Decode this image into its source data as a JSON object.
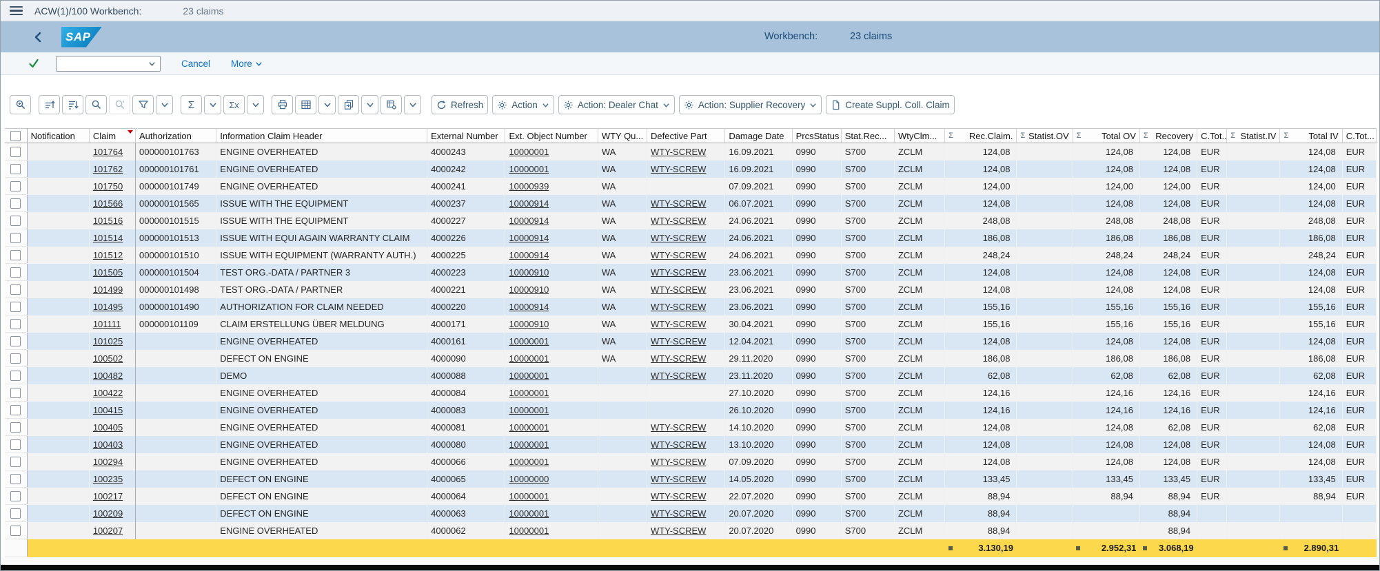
{
  "window": {
    "title": "ACW(1)/100 Workbench:",
    "subtitle": "23 claims"
  },
  "appbar": {
    "brand": "SAP",
    "workbench_label": "Workbench:",
    "workbench_value": "23 claims"
  },
  "actionbar": {
    "combobox_value": "",
    "cancel_label": "Cancel",
    "more_label": "More"
  },
  "toolbar": {
    "sum_icon": "Σ",
    "subtotal_icon": "Σx",
    "refresh_label": "Refresh",
    "action_label": "Action",
    "dealer_chat_label": "Action: Dealer Chat",
    "supplier_recovery_label": "Action: Supplier Recovery",
    "create_claim_label": "Create Suppl. Coll. Claim"
  },
  "colors": {
    "appbar_blue": "#a8c2db",
    "link_blue": "#0a6ed1",
    "zebra_blue": "#d9e6f4",
    "zebra_gray": "#f2f2f2",
    "totals_yellow": "#fbd84c",
    "sort_indicator_red": "#c40000",
    "check_green": "#188a3f"
  },
  "table": {
    "sigma_icon": "Σ",
    "columns": {
      "notification": "Notification",
      "claim": "Claim",
      "authorization": "Authorization",
      "info_header": "Information Claim Header",
      "ext_number": "External Number",
      "ext_object": "Ext. Object Number",
      "wty_qu": "WTY Qu...",
      "defective_part": "Defective Part",
      "damage_date": "Damage Date",
      "prcs_status": "PrcsStatus",
      "stat_rec": "Stat.Rec...",
      "wty_clm": "WtyClm...",
      "rec_claim": "Rec.Claim.",
      "statist_ov": "Statist.OV",
      "total_ov": "Total OV",
      "recovery": "Recovery",
      "c_tot1": "C.Tot...",
      "statist_iv": "Statist.IV",
      "total_iv": "Total IV",
      "c_tot2": "C.Tot..."
    },
    "rows": [
      [
        "",
        "101764",
        "000000101763",
        "ENGINE OVERHEATED",
        "4000243",
        "10000001",
        "WA",
        "WTY-SCREW",
        "16.09.2021",
        "0990",
        "S700",
        "ZCLM",
        "124,08",
        "",
        "124,08",
        "124,08",
        "EUR",
        "",
        "124,08",
        "EUR"
      ],
      [
        "",
        "101762",
        "000000101761",
        "ENGINE OVERHEATED",
        "4000242",
        "10000001",
        "WA",
        "WTY-SCREW",
        "16.09.2021",
        "0990",
        "S700",
        "ZCLM",
        "124,08",
        "",
        "124,08",
        "124,08",
        "EUR",
        "",
        "124,08",
        "EUR"
      ],
      [
        "",
        "101750",
        "000000101749",
        "ENGINE OVERHEATED",
        "4000241",
        "10000939",
        "WA",
        "",
        "07.09.2021",
        "0990",
        "S700",
        "ZCLM",
        "124,00",
        "",
        "124,00",
        "124,00",
        "EUR",
        "",
        "124,00",
        "EUR"
      ],
      [
        "",
        "101566",
        "000000101565",
        "ISSUE WITH THE EQUIPMENT",
        "4000237",
        "10000914",
        "WA",
        "WTY-SCREW",
        "06.07.2021",
        "0990",
        "S700",
        "ZCLM",
        "124,08",
        "",
        "124,08",
        "124,08",
        "EUR",
        "",
        "124,08",
        "EUR"
      ],
      [
        "",
        "101516",
        "000000101515",
        "ISSUE WITH THE EQUIPMENT",
        "4000227",
        "10000914",
        "WA",
        "WTY-SCREW",
        "24.06.2021",
        "0990",
        "S700",
        "ZCLM",
        "248,08",
        "",
        "248,08",
        "248,08",
        "EUR",
        "",
        "248,08",
        "EUR"
      ],
      [
        "",
        "101514",
        "000000101513",
        "ISSUE WITH EQUI AGAIN WARRANTY CLAIM",
        "4000226",
        "10000914",
        "WA",
        "WTY-SCREW",
        "24.06.2021",
        "0990",
        "S700",
        "ZCLM",
        "186,08",
        "",
        "186,08",
        "186,08",
        "EUR",
        "",
        "186,08",
        "EUR"
      ],
      [
        "",
        "101512",
        "000000101510",
        "ISSUE WITH EQUIPMENT (WARRANTY AUTH.)",
        "4000225",
        "10000914",
        "WA",
        "WTY-SCREW",
        "24.06.2021",
        "0990",
        "S700",
        "ZCLM",
        "248,24",
        "",
        "248,24",
        "248,24",
        "EUR",
        "",
        "248,24",
        "EUR"
      ],
      [
        "",
        "101505",
        "000000101504",
        "TEST ORG.-DATA / PARTNER 3",
        "4000223",
        "10000910",
        "WA",
        "WTY-SCREW",
        "23.06.2021",
        "0990",
        "S700",
        "ZCLM",
        "124,08",
        "",
        "124,08",
        "124,08",
        "EUR",
        "",
        "124,08",
        "EUR"
      ],
      [
        "",
        "101499",
        "000000101498",
        "TEST ORG.-DATA / PARTNER",
        "4000221",
        "10000910",
        "WA",
        "WTY-SCREW",
        "23.06.2021",
        "0990",
        "S700",
        "ZCLM",
        "124,08",
        "",
        "124,08",
        "124,08",
        "EUR",
        "",
        "124,08",
        "EUR"
      ],
      [
        "",
        "101495",
        "000000101490",
        "AUTHORIZATION FOR CLAIM NEEDED",
        "4000220",
        "10000914",
        "WA",
        "WTY-SCREW",
        "23.06.2021",
        "0990",
        "S700",
        "ZCLM",
        "155,16",
        "",
        "155,16",
        "155,16",
        "EUR",
        "",
        "155,16",
        "EUR"
      ],
      [
        "",
        "101111",
        "000000101109",
        "CLAIM ERSTELLUNG ÜBER MELDUNG",
        "4000171",
        "10000910",
        "WA",
        "WTY-SCREW",
        "30.04.2021",
        "0990",
        "S700",
        "ZCLM",
        "155,16",
        "",
        "155,16",
        "155,16",
        "EUR",
        "",
        "155,16",
        "EUR"
      ],
      [
        "",
        "101025",
        "",
        "ENGINE OVERHEATED",
        "4000161",
        "10000001",
        "WA",
        "WTY-SCREW",
        "12.04.2021",
        "0990",
        "S700",
        "ZCLM",
        "124,08",
        "",
        "124,08",
        "124,08",
        "EUR",
        "",
        "124,08",
        "EUR"
      ],
      [
        "",
        "100502",
        "",
        "DEFECT ON ENGINE",
        "4000090",
        "10000001",
        "WA",
        "WTY-SCREW",
        "29.11.2020",
        "0990",
        "S700",
        "ZCLM",
        "186,08",
        "",
        "186,08",
        "186,08",
        "EUR",
        "",
        "186,08",
        "EUR"
      ],
      [
        "",
        "100482",
        "",
        "DEMO",
        "4000088",
        "10000001",
        "",
        "WTY-SCREW",
        "23.11.2020",
        "0990",
        "S700",
        "ZCLM",
        "62,08",
        "",
        "62,08",
        "62,08",
        "EUR",
        "",
        "62,08",
        "EUR"
      ],
      [
        "",
        "100422",
        "",
        "ENGINE OVERHEATED",
        "4000084",
        "10000001",
        "",
        "",
        "27.10.2020",
        "0990",
        "S700",
        "ZCLM",
        "124,16",
        "",
        "124,16",
        "124,16",
        "EUR",
        "",
        "124,16",
        "EUR"
      ],
      [
        "",
        "100415",
        "",
        "ENGINE OVERHEATED",
        "4000083",
        "10000001",
        "",
        "",
        "26.10.2020",
        "0990",
        "S700",
        "ZCLM",
        "124,16",
        "",
        "124,16",
        "124,16",
        "EUR",
        "",
        "124,16",
        "EUR"
      ],
      [
        "",
        "100405",
        "",
        "ENGINE OVERHEATED",
        "4000081",
        "10000001",
        "",
        "WTY-SCREW",
        "14.10.2020",
        "0990",
        "S700",
        "ZCLM",
        "124,08",
        "",
        "124,08",
        "62,08",
        "EUR",
        "",
        "62,08",
        "EUR"
      ],
      [
        "",
        "100403",
        "",
        "ENGINE OVERHEATED",
        "4000080",
        "10000001",
        "",
        "WTY-SCREW",
        "13.10.2020",
        "0990",
        "S700",
        "ZCLM",
        "124,08",
        "",
        "124,08",
        "124,08",
        "EUR",
        "",
        "124,08",
        "EUR"
      ],
      [
        "",
        "100294",
        "",
        "ENGINE OVERHEATED",
        "4000066",
        "10000001",
        "",
        "WTY-SCREW",
        "07.09.2020",
        "0990",
        "S700",
        "ZCLM",
        "124,08",
        "",
        "124,08",
        "124,08",
        "EUR",
        "",
        "124,08",
        "EUR"
      ],
      [
        "",
        "100235",
        "",
        "DEFECT ON ENGINE",
        "4000065",
        "10000000",
        "",
        "WTY-SCREW",
        "14.05.2020",
        "0990",
        "S700",
        "ZCLM",
        "133,45",
        "",
        "133,45",
        "133,45",
        "EUR",
        "",
        "133,45",
        "EUR"
      ],
      [
        "",
        "100217",
        "",
        "DEFECT ON ENGINE",
        "4000064",
        "10000001",
        "",
        "WTY-SCREW",
        "22.07.2020",
        "0990",
        "S700",
        "ZCLM",
        "88,94",
        "",
        "88,94",
        "88,94",
        "EUR",
        "",
        "88,94",
        "EUR"
      ],
      [
        "",
        "100209",
        "",
        "DEFECT ON ENGINE",
        "4000063",
        "10000001",
        "",
        "WTY-SCREW",
        "20.07.2020",
        "0990",
        "S700",
        "ZCLM",
        "88,94",
        "",
        "",
        "88,94",
        "",
        "",
        "",
        ""
      ],
      [
        "",
        "100207",
        "",
        "ENGINE OVERHEATED",
        "4000062",
        "10000001",
        "",
        "WTY-SCREW",
        "20.07.2020",
        "0990",
        "S700",
        "ZCLM",
        "88,94",
        "",
        "",
        "88,94",
        "",
        "",
        "",
        ""
      ]
    ],
    "totals": {
      "rec_claim": "3.130,19",
      "total_ov": "2.952,31",
      "recovery": "3.068,19",
      "total_iv": "2.890,31"
    }
  }
}
